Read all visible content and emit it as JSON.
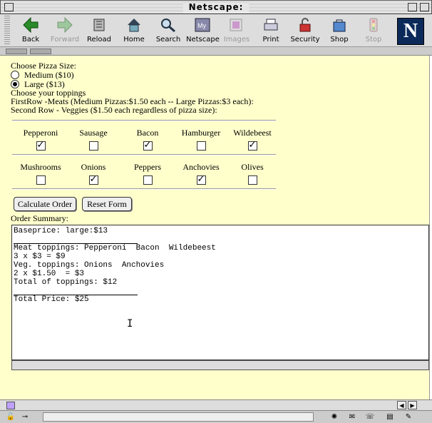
{
  "window": {
    "title": "Netscape:"
  },
  "toolbar": {
    "buttons": [
      {
        "label": "Back",
        "icon": "back-arrow-icon",
        "enabled": true
      },
      {
        "label": "Forward",
        "icon": "forward-arrow-icon",
        "enabled": false
      },
      {
        "label": "Reload",
        "icon": "reload-icon",
        "enabled": true
      },
      {
        "label": "Home",
        "icon": "home-icon",
        "enabled": true
      },
      {
        "label": "Search",
        "icon": "search-icon",
        "enabled": true
      },
      {
        "label": "Netscape",
        "icon": "netscape-icon",
        "enabled": true
      },
      {
        "label": "Images",
        "icon": "images-icon",
        "enabled": false
      },
      {
        "label": "Print",
        "icon": "print-icon",
        "enabled": true
      },
      {
        "label": "Security",
        "icon": "security-lock-icon",
        "enabled": true
      },
      {
        "label": "Shop",
        "icon": "shop-bag-icon",
        "enabled": true
      },
      {
        "label": "Stop",
        "icon": "stop-icon",
        "enabled": false
      }
    ],
    "logo": "N"
  },
  "form": {
    "size_heading": "Choose Pizza Size:",
    "sizes": [
      {
        "label": "Medium ($10)",
        "selected": false
      },
      {
        "label": "Large ($13)",
        "selected": true
      }
    ],
    "toppings_heading": "Choose your toppings",
    "meats_note": "FirstRow -Meats (Medium Pizzas:$1.50 each -- Large Pizzas:$3 each):",
    "veggies_note": "Second Row - Veggies ($1.50 each regardless of pizza size):",
    "meats": [
      {
        "label": "Pepperoni",
        "checked": true
      },
      {
        "label": "Sausage",
        "checked": false
      },
      {
        "label": "Bacon",
        "checked": true
      },
      {
        "label": "Hamburger",
        "checked": false
      },
      {
        "label": "Wildebeest",
        "checked": true
      }
    ],
    "veggies": [
      {
        "label": "Mushrooms",
        "checked": false
      },
      {
        "label": "Onions",
        "checked": true
      },
      {
        "label": "Peppers",
        "checked": false
      },
      {
        "label": "Anchovies",
        "checked": true
      },
      {
        "label": "Olives",
        "checked": false
      }
    ],
    "calculate_label": "Calculate Order",
    "reset_label": "Reset Form",
    "summary_heading": "Order Summary:"
  },
  "summary": {
    "lines": [
      "Baseprice: large:$13",
      "",
      "Meat toppings: Pepperoni  Bacon  Wildebeest",
      "3 x $3 = $9",
      "Veg. toppings: Onions  Anchovies",
      "2 x $1.50  = $3",
      "Total of toppings: $12",
      "",
      "Total Price: $25"
    ]
  }
}
